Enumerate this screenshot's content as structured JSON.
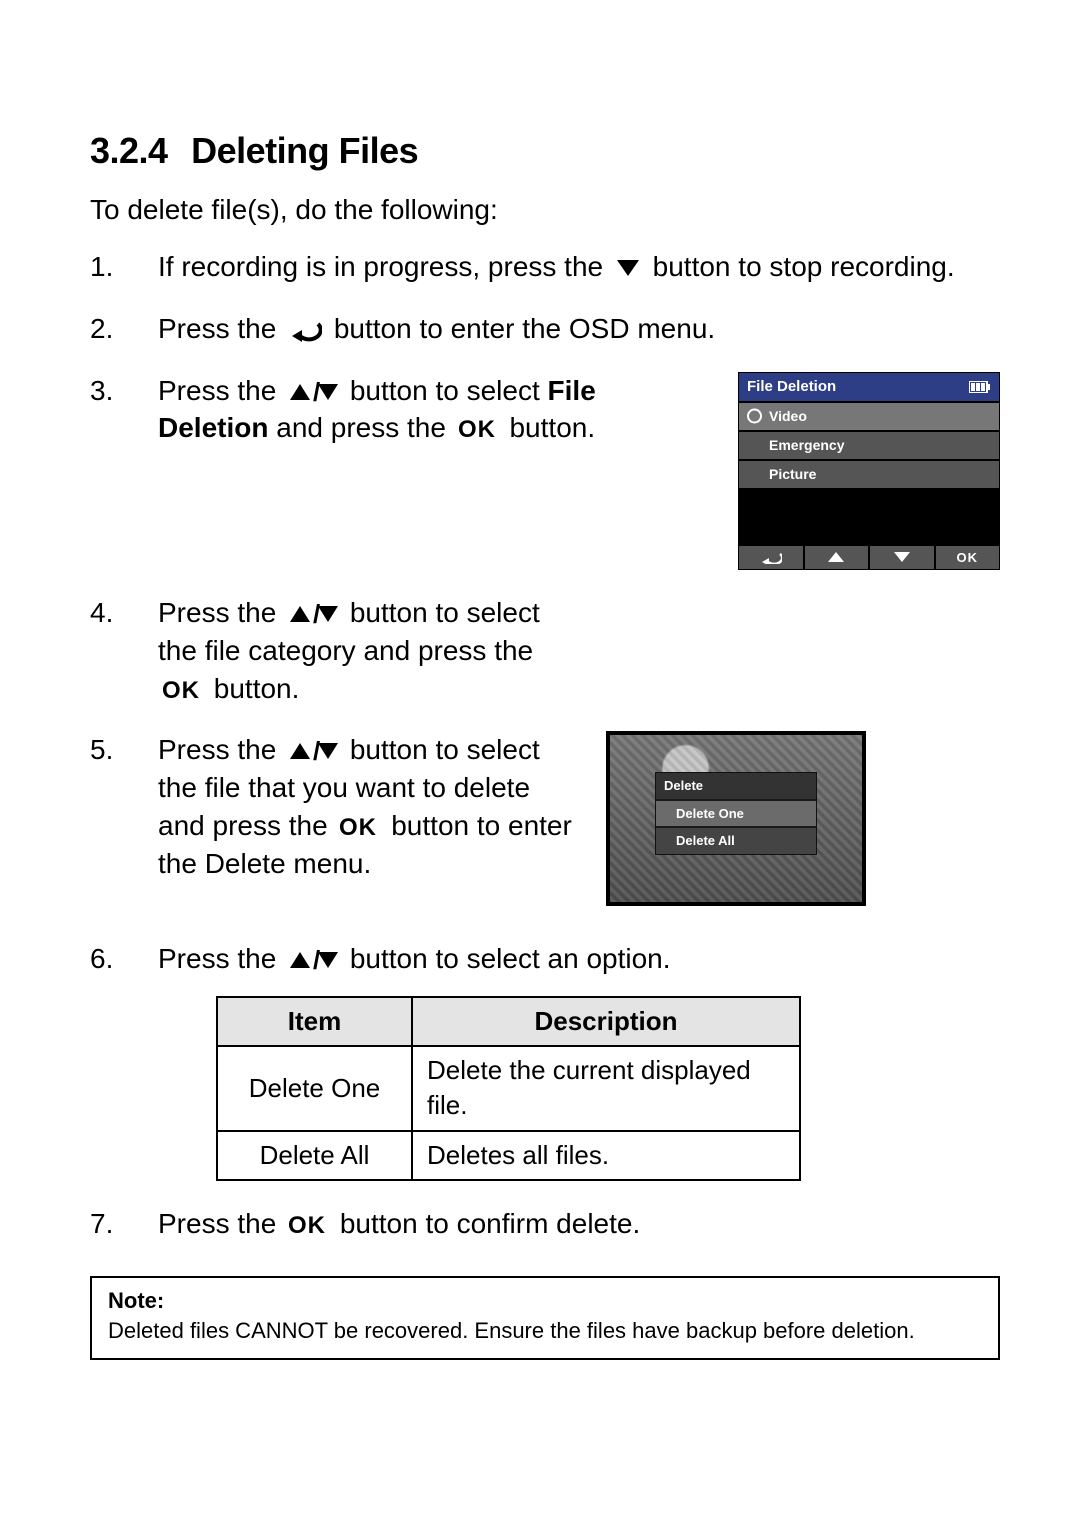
{
  "section": {
    "number": "3.2.4",
    "title": "Deleting Files"
  },
  "intro": "To delete file(s), do the following:",
  "steps": {
    "s1a": "If recording is in progress, press the",
    "s1b": "button to stop recording.",
    "s2a": "Press the",
    "s2b": "button to enter the OSD menu.",
    "s3a": "Press the",
    "s3b": "button to select",
    "s3c": "File Deletion",
    "s3d": "and press the",
    "s3e": "button.",
    "s4a": "Press the",
    "s4b": "button to select the file category and press the",
    "s4c": "button.",
    "s5a": "Press the",
    "s5b": "button to select the file that you want to delete and press the",
    "s5c": "button to enter the Delete menu.",
    "s6a": "Press the",
    "s6b": "button to select an option.",
    "s7a": "Press the",
    "s7b": "button to confirm delete."
  },
  "osd": {
    "title": "File Deletion",
    "items": [
      {
        "label": "Video",
        "selected": true,
        "dot": true
      },
      {
        "label": "Emergency",
        "selected": false,
        "dot": false
      },
      {
        "label": "Picture",
        "selected": false,
        "dot": false
      }
    ],
    "foot_ok": "OK"
  },
  "delete_menu": {
    "title": "Delete",
    "items": [
      {
        "label": "Delete One",
        "selected": true
      },
      {
        "label": "Delete All",
        "selected": false
      }
    ]
  },
  "table": {
    "head_item": "Item",
    "head_desc": "Description",
    "rows": [
      {
        "item": "Delete One",
        "desc": "Delete the current displayed file."
      },
      {
        "item": "Delete All",
        "desc": "Deletes all files."
      }
    ]
  },
  "note": {
    "head": "Note:",
    "body": "Deleted files CANNOT be recovered. Ensure the files have backup before deletion."
  },
  "icons": {
    "ok_text": "OK"
  }
}
